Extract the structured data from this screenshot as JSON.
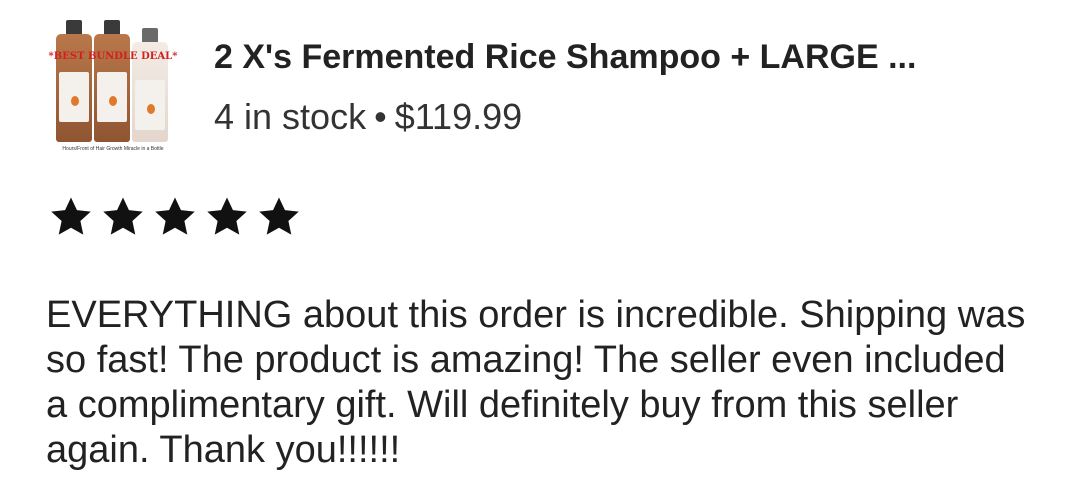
{
  "product": {
    "title": "2 X's Fermented Rice Shampoo + LARGE ...",
    "stock": "4 in stock",
    "separator": "•",
    "price": "$119.99",
    "thumbnail": {
      "badge": "*BEST BUNDLE DEAL*",
      "caption": "Hours/Front of Hair Growth Miracle in a Bottle"
    }
  },
  "rating": {
    "stars": 5,
    "max": 5,
    "icon": "star-icon",
    "color": "#111111"
  },
  "review": {
    "text": "EVERYTHING about this order is incredible. Shipping was so fast! The product is amazing! The seller even included a complimentary gift. Will definitely buy from this seller again. Thank you!!!!!!"
  }
}
